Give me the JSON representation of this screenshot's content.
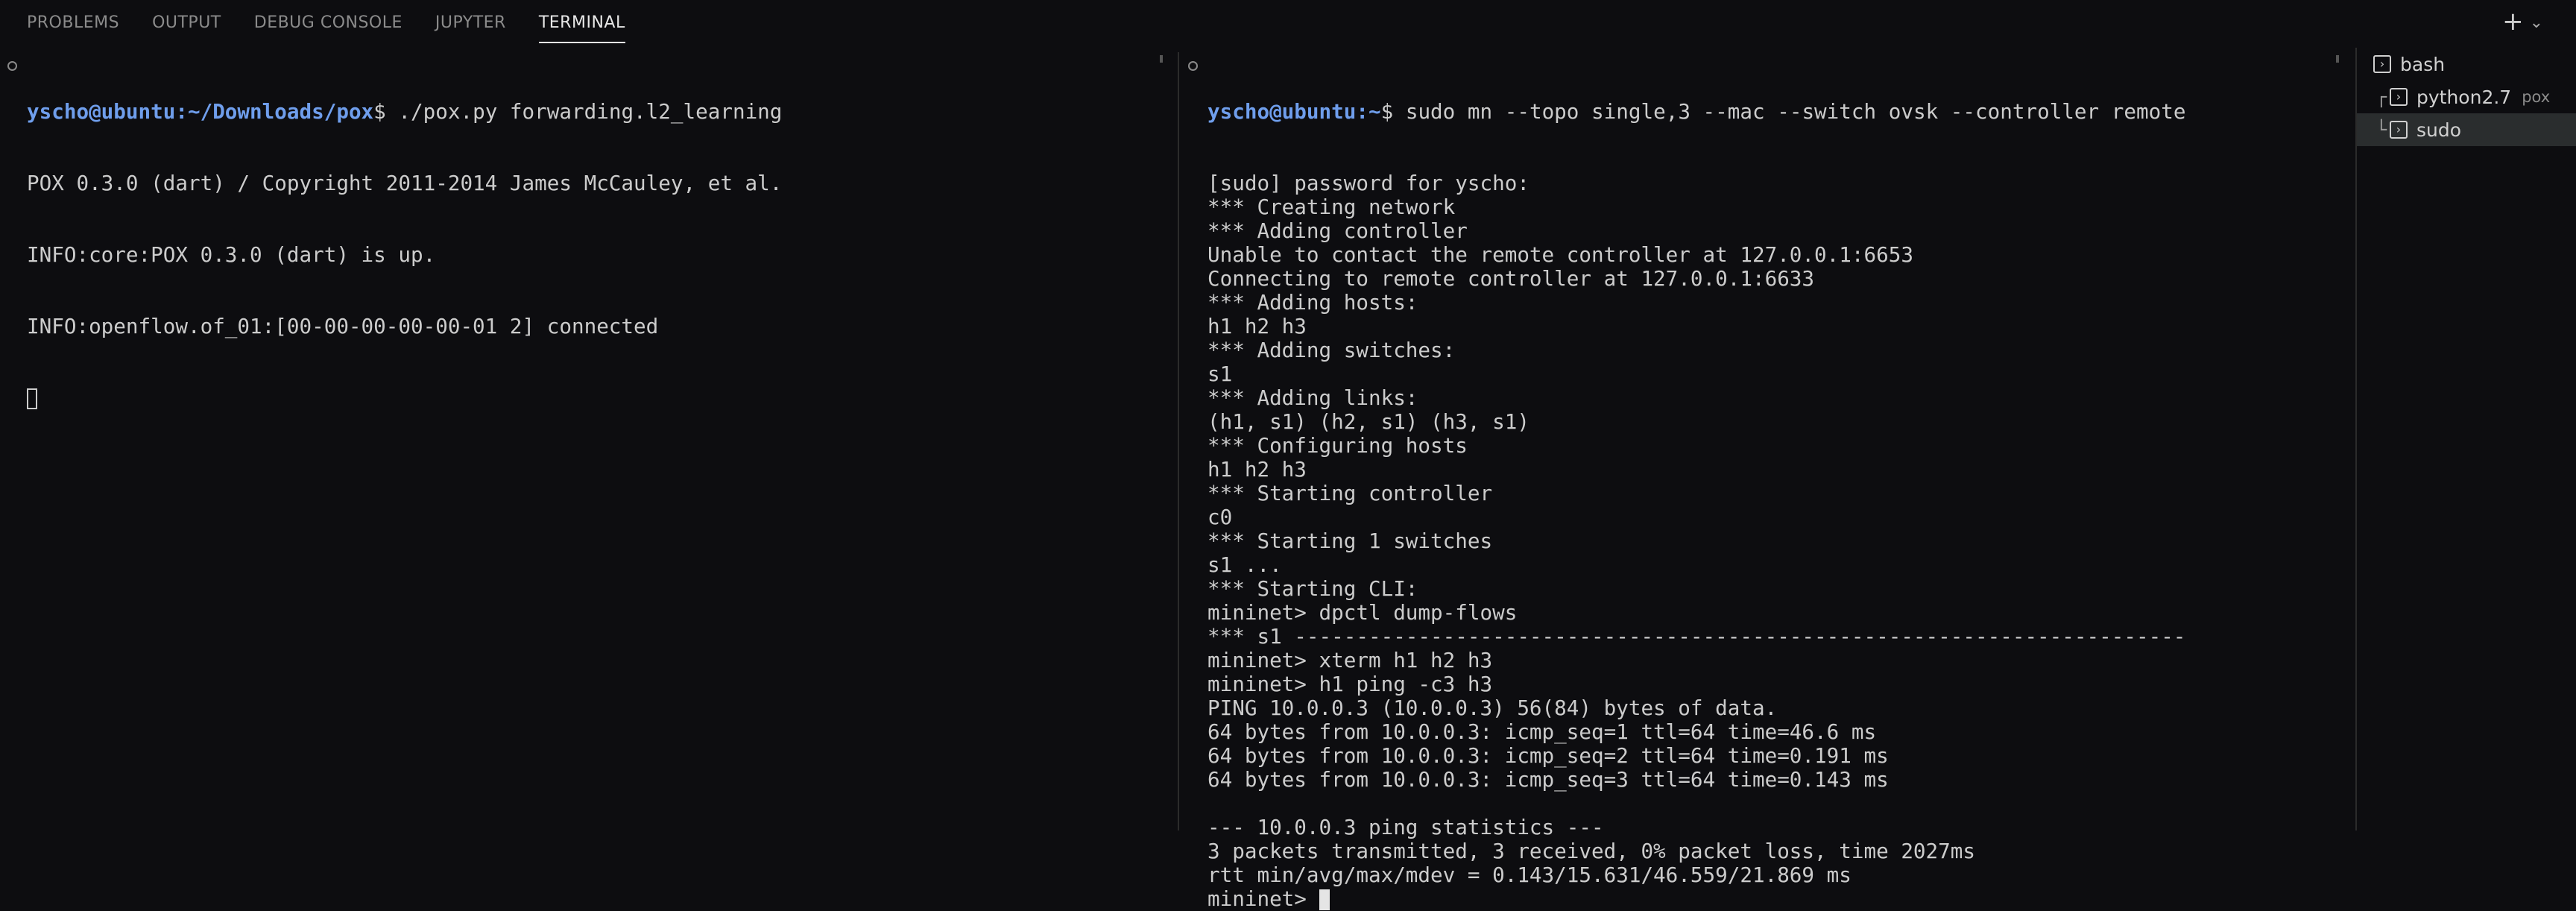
{
  "panel_tabs": [
    "PROBLEMS",
    "OUTPUT",
    "DEBUG CONSOLE",
    "JUPYTER",
    "TERMINAL"
  ],
  "active_tab": "TERMINAL",
  "new_terminal": {
    "plus": "+",
    "caret": "⌄"
  },
  "left_terminal": {
    "prompt": {
      "user_host": "yscho@ubuntu",
      "path": ":~/Downloads/pox",
      "symbol": "$",
      "command": " ./pox.py forwarding.l2_learning"
    },
    "lines": [
      "POX 0.3.0 (dart) / Copyright 2011-2014 James McCauley, et al.",
      "INFO:core:POX 0.3.0 (dart) is up.",
      "INFO:openflow.of_01:[00-00-00-00-00-01 2] connected"
    ]
  },
  "right_terminal": {
    "prompt": {
      "user_host": "yscho@ubuntu",
      "path": ":~",
      "symbol": "$",
      "command": " sudo mn --topo single,3 --mac --switch ovsk --controller remote"
    },
    "lines": [
      "[sudo] password for yscho:",
      "*** Creating network",
      "*** Adding controller",
      "Unable to contact the remote controller at 127.0.0.1:6653",
      "Connecting to remote controller at 127.0.0.1:6633",
      "*** Adding hosts:",
      "h1 h2 h3",
      "*** Adding switches:",
      "s1",
      "*** Adding links:",
      "(h1, s1) (h2, s1) (h3, s1)",
      "*** Configuring hosts",
      "h1 h2 h3",
      "*** Starting controller",
      "c0",
      "*** Starting 1 switches",
      "s1 ...",
      "*** Starting CLI:",
      "mininet> dpctl dump-flows",
      "*** s1 ------------------------------------------------------------------------",
      "mininet> xterm h1 h2 h3",
      "mininet> h1 ping -c3 h3",
      "PING 10.0.0.3 (10.0.0.3) 56(84) bytes of data.",
      "64 bytes from 10.0.0.3: icmp_seq=1 ttl=64 time=46.6 ms",
      "64 bytes from 10.0.0.3: icmp_seq=2 ttl=64 time=0.191 ms",
      "64 bytes from 10.0.0.3: icmp_seq=3 ttl=64 time=0.143 ms",
      "",
      "--- 10.0.0.3 ping statistics ---",
      "3 packets transmitted, 3 received, 0% packet loss, time 2027ms",
      "rtt min/avg/max/mdev = 0.143/15.631/46.559/21.869 ms"
    ],
    "final_prompt": "mininet> "
  },
  "terminal_list": [
    {
      "name": "bash",
      "sub": "",
      "tree": "",
      "selected": false
    },
    {
      "name": "python2.7",
      "sub": "pox",
      "tree": "┌",
      "selected": false
    },
    {
      "name": "sudo",
      "sub": "",
      "tree": "└",
      "selected": true
    }
  ],
  "icons": {
    "terminal": "terminal-icon",
    "pane": "pane-status-dot"
  },
  "colors": {
    "background": "#0d0d10",
    "prompt": "#6f9eec",
    "text": "#cccccc",
    "selected_row": "#2a2d2e"
  }
}
